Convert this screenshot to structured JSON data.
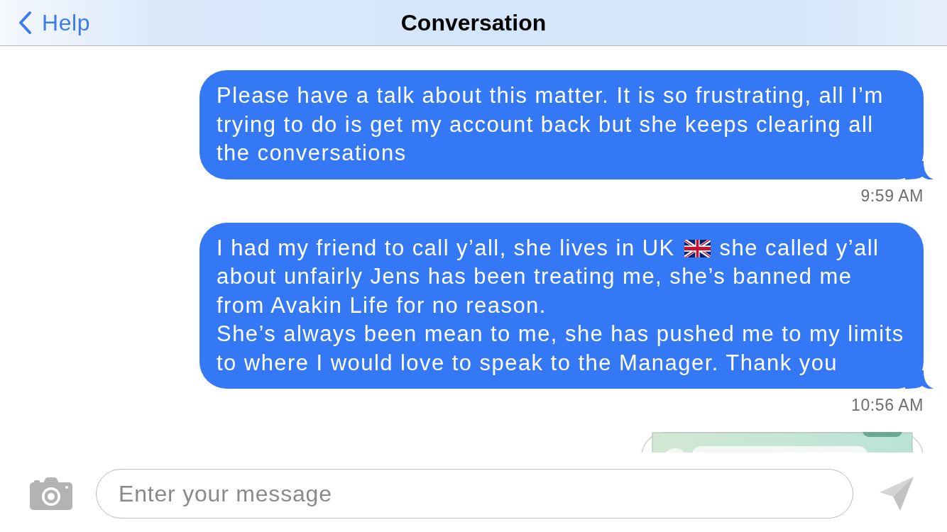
{
  "header": {
    "back_label": "Help",
    "title": "Conversation"
  },
  "messages": [
    {
      "kind": "text",
      "parts": [
        {
          "kind": "text",
          "text": "Please have a talk about this matter. It is so frustrating, all I’m trying to do is get my account back but she keeps clearing all the conversations"
        }
      ],
      "time": "9:59 AM"
    },
    {
      "kind": "text",
      "parts": [
        {
          "kind": "text",
          "text": "I had my friend to call y’all, she lives in UK"
        },
        {
          "kind": "emoji"
        },
        {
          "kind": "text",
          "text": "she called y’all about unfairly Jens has been treating me, she’s banned me from Avakin Life for no reason.\nShe’s always been mean to me, she has pushed me to my limits to where I would love to speak to the Manager. Thank you"
        }
      ],
      "time": "10:56 AM"
    },
    {
      "kind": "image"
    }
  ],
  "composer": {
    "placeholder": "Enter your message"
  }
}
